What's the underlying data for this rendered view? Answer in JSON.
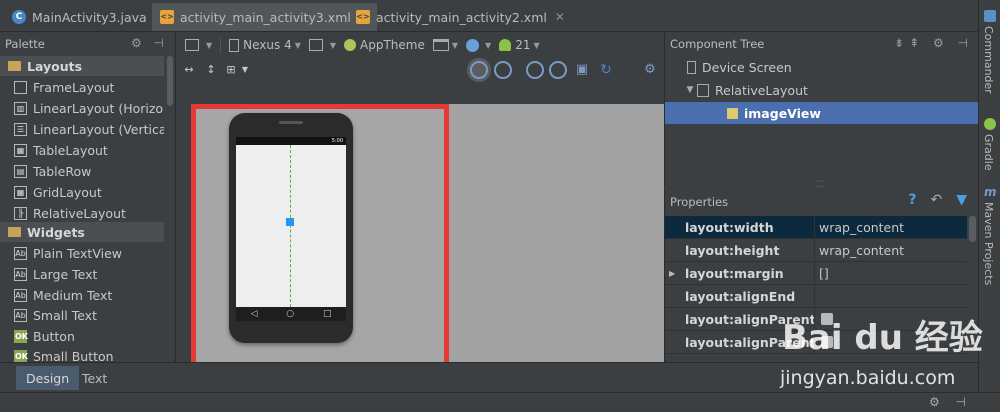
{
  "tabs": [
    {
      "label": "MainActivity3.java",
      "icon": "java-class-icon",
      "active": false
    },
    {
      "label": "activity_main_activity3.xml",
      "icon": "xml-layout-icon",
      "active": true
    },
    {
      "label": "activity_main_activity2.xml",
      "icon": "xml-layout-icon",
      "active": false
    }
  ],
  "palette": {
    "title": "Palette",
    "groups": [
      {
        "label": "Layouts",
        "items": [
          "FrameLayout",
          "LinearLayout (Horizontal)",
          "LinearLayout (Vertical)",
          "TableLayout",
          "TableRow",
          "GridLayout",
          "RelativeLayout"
        ]
      },
      {
        "label": "Widgets",
        "items": [
          "Plain TextView",
          "Large Text",
          "Medium Text",
          "Small Text",
          "Button",
          "Small Button"
        ]
      }
    ]
  },
  "toolbar": {
    "device": "Nexus 4",
    "theme": "AppTheme",
    "api": "21"
  },
  "phone": {
    "status_time": "5:00"
  },
  "component_tree": {
    "title": "Component Tree",
    "nodes": [
      {
        "label": "Device Screen",
        "level": 0
      },
      {
        "label": "RelativeLayout",
        "level": 1
      },
      {
        "label": "imageView",
        "level": 2,
        "selected": true
      }
    ]
  },
  "properties": {
    "title": "Properties",
    "rows": [
      {
        "name": "layout:width",
        "value": "wrap_content",
        "selected": true
      },
      {
        "name": "layout:height",
        "value": "wrap_content"
      },
      {
        "name": "layout:margin",
        "value": "[]",
        "expandable": true
      },
      {
        "name": "layout:alignEnd",
        "value": ""
      },
      {
        "name": "layout:alignParentEnd",
        "value": ""
      },
      {
        "name": "layout:alignParentStart",
        "value": ""
      }
    ]
  },
  "right_tools": [
    "Commander",
    "Gradle",
    "Maven Projects"
  ],
  "bottom_tabs": [
    {
      "label": "Design",
      "active": true
    },
    {
      "label": "Text",
      "active": false
    }
  ],
  "watermark": {
    "logo": "Bai du 经验",
    "url": "jingyan.baidu.com"
  },
  "colors": {
    "selection_highlight": "#e53935",
    "tree_selected": "#4b6eaf",
    "guide": "#4caf50",
    "image_view": "#2196f3"
  }
}
